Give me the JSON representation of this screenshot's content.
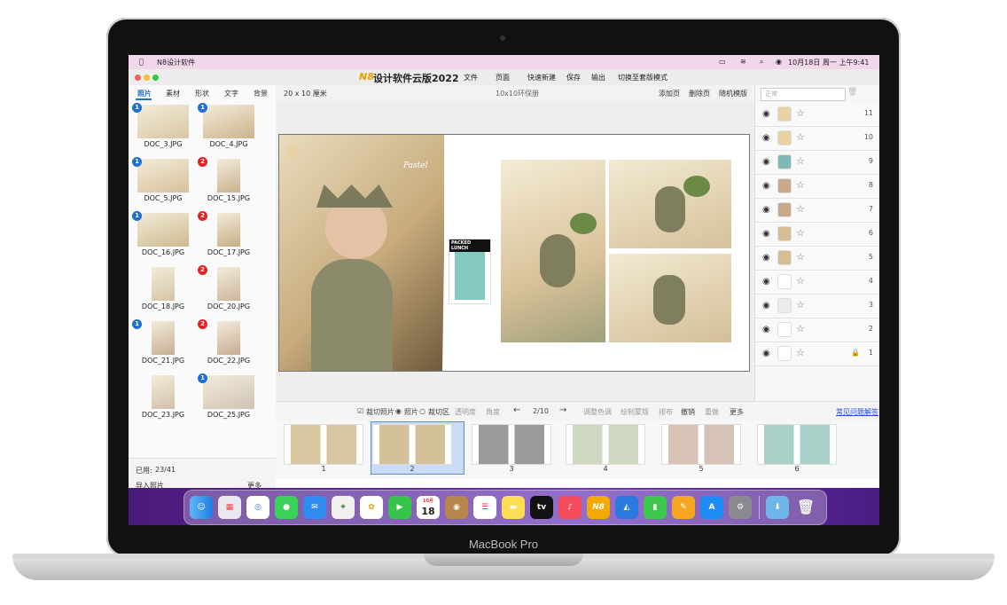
{
  "menubar": {
    "apple": "",
    "app_name": "N8设计软件",
    "clock": "10月18日 周一 上午9:41"
  },
  "window": {
    "title": "设计软件云版2022",
    "logo": "N8",
    "menus": [
      "文件",
      "页面",
      "快速新建",
      "保存",
      "输出",
      "切换至套版模式"
    ]
  },
  "left_tabs": [
    "照片",
    "素材",
    "形状",
    "文字",
    "背景"
  ],
  "photos": [
    {
      "name": "DOC_3.JPG",
      "badge": "1",
      "color": "blue",
      "tone": "#d8c7a4"
    },
    {
      "name": "DOC_4.JPG",
      "badge": "1",
      "color": "blue",
      "tone": "#cbb48c"
    },
    {
      "name": "DOC_5.JPG",
      "badge": "1",
      "color": "blue",
      "tone": "#d6c09a"
    },
    {
      "name": "DOC_15.JPG",
      "badge": "2",
      "color": "red",
      "tone": "#c9b28d"
    },
    {
      "name": "DOC_16.JPG",
      "badge": "1",
      "color": "blue",
      "tone": "#cdb98f"
    },
    {
      "name": "DOC_17.JPG",
      "badge": "2",
      "color": "red",
      "tone": "#c6ad83"
    },
    {
      "name": "DOC_18.JPG",
      "badge": "",
      "color": "",
      "tone": "#d4c4a7"
    },
    {
      "name": "DOC_20.JPG",
      "badge": "2",
      "color": "red",
      "tone": "#ccb69c"
    },
    {
      "name": "DOC_21.JPG",
      "badge": "1",
      "color": "blue",
      "tone": "#c7ad94"
    },
    {
      "name": "DOC_22.JPG",
      "badge": "2",
      "color": "red",
      "tone": "#c9ab92"
    },
    {
      "name": "DOC_23.JPG",
      "badge": "",
      "color": "",
      "tone": "#d2c0ab"
    },
    {
      "name": "DOC_25.JPG",
      "badge": "1",
      "color": "blue",
      "tone": "#cfc3b4"
    }
  ],
  "left_footer": {
    "used_label": "已用:",
    "used_value": "23/41",
    "import": "导入照片",
    "more": "更多"
  },
  "canvas_header": {
    "size": "20 x 10 厘米",
    "product": "10x10环保册",
    "add_page": "添加页",
    "delete_page": "删除页",
    "random": "随机模版"
  },
  "spread": {
    "label_tag": "PACKED LUNCH",
    "signature": "Pastel"
  },
  "layers": {
    "mode_placeholder": "正常",
    "items": [
      {
        "num": "11",
        "tone": "#e8d2a3",
        "lock": false
      },
      {
        "num": "10",
        "tone": "#e8d2a3",
        "lock": false
      },
      {
        "num": "9",
        "tone": "#7fb9b5",
        "lock": false
      },
      {
        "num": "8",
        "tone": "#c8a98a",
        "lock": false
      },
      {
        "num": "7",
        "tone": "#c8a98a",
        "lock": false
      },
      {
        "num": "6",
        "tone": "#d6be94",
        "lock": false
      },
      {
        "num": "5",
        "tone": "#d6be94",
        "lock": false
      },
      {
        "num": "4",
        "tone": "#ffffff",
        "lock": false
      },
      {
        "num": "3",
        "tone": "#ececec",
        "lock": false
      },
      {
        "num": "2",
        "tone": "#ffffff",
        "lock": false
      },
      {
        "num": "1",
        "tone": "#ffffff",
        "lock": true
      }
    ]
  },
  "toolbar": {
    "crop_photo": "裁切照片",
    "photo": "照片",
    "crop_area": "裁切区",
    "opacity": "透明度",
    "angle": "角度",
    "page_indicator": "2/10",
    "adjust_color": "调整色调",
    "draw_mask": "绘制蒙版",
    "arrange": "排布",
    "undo": "撤销",
    "redo": "重做",
    "more": "更多",
    "faq": "常见问题解答"
  },
  "pages": [
    "1",
    "2",
    "3",
    "4",
    "5",
    "6"
  ],
  "laptop_brand": "MacBook Pro",
  "dock": {
    "calendar_day": "18",
    "calendar_month": "10月",
    "tv": "tv",
    "n8": "N8"
  }
}
